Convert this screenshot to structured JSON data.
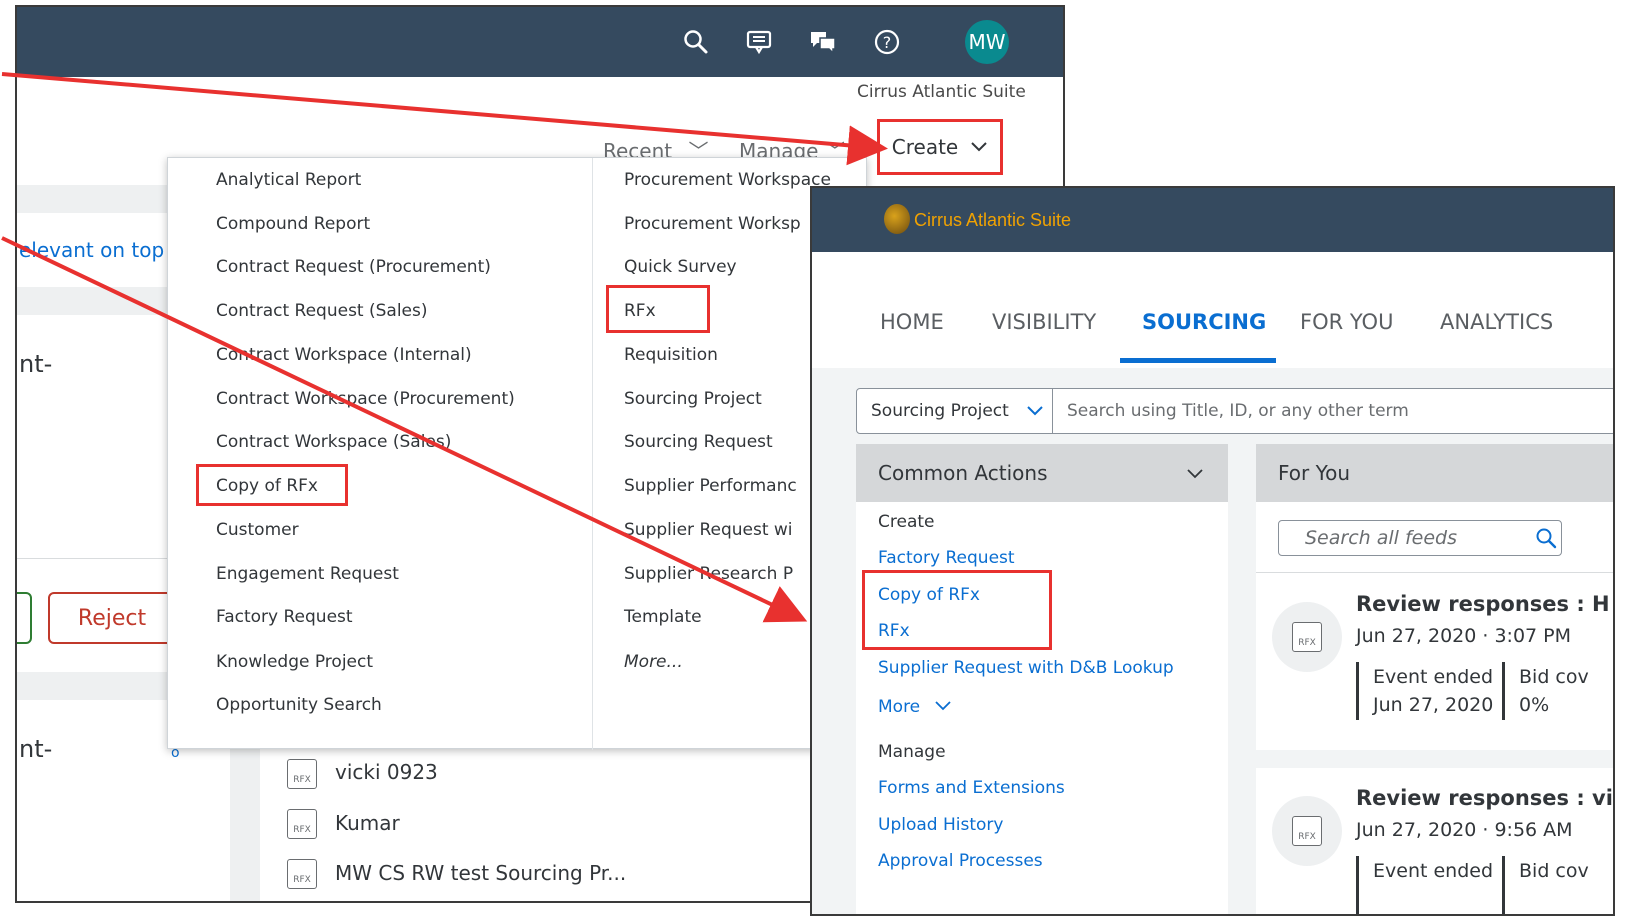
{
  "colors": {
    "shell": "#354a5f",
    "accent_blue": "#0a6ed1",
    "highlight_red": "#e8312f",
    "avatar_bg": "#0a8a8f",
    "logo_orange": "#f0a202"
  },
  "bg_window": {
    "avatar_initials": "MW",
    "suite_name": "Cirrus Atlantic Suite",
    "icons": [
      "search-icon",
      "feedback-icon",
      "chat-icon",
      "help-icon"
    ],
    "nav": {
      "recent": "Recent",
      "manage": "Manage",
      "create": "Create"
    },
    "fragments": {
      "relevant": "elevant on top",
      "doc1": "nt-",
      "doc2": "nt-",
      "reject": "Reject"
    },
    "list": [
      "vicki 0923",
      "Kumar",
      "MW CS RW test Sourcing Pr..."
    ],
    "rfx_label": "RFX"
  },
  "create_menu": {
    "col1": [
      "Analytical Report",
      "Compound Report",
      "Contract Request (Procurement)",
      "Contract Request (Sales)",
      "Contract Workspace (Internal)",
      "Contract Workspace (Procurement)",
      "Contract Workspace (Sales)",
      "Copy of RFx",
      "Customer",
      "Engagement Request",
      "Factory Request",
      "Knowledge Project",
      "Opportunity Search"
    ],
    "col2": [
      "Procurement Workspace",
      "Procurement Worksp",
      "Quick Survey",
      "RFx",
      "Requisition",
      "Sourcing Project",
      "Sourcing Request",
      "Supplier Performanc",
      "Supplier Request wi",
      "Supplier Research P",
      "Template",
      "More..."
    ]
  },
  "fg_window": {
    "logo_text": "Cirrus Atlantic Suite",
    "tabs": [
      "HOME",
      "VISIBILITY",
      "SOURCING",
      "FOR YOU",
      "ANALYTICS"
    ],
    "active_tab": "SOURCING",
    "search": {
      "category": "Sourcing Project",
      "placeholder": "Search using Title, ID, or any other term"
    },
    "common_actions": {
      "title": "Common Actions",
      "create_heading": "Create",
      "create_links": [
        "Factory Request",
        "Copy of RFx",
        "RFx",
        "Supplier Request with D&B Lookup"
      ],
      "more": "More",
      "manage_heading": "Manage",
      "manage_links": [
        "Forms and Extensions",
        "Upload History",
        "Approval Processes"
      ]
    },
    "for_you": {
      "title": "For You",
      "search_placeholder": "Search all feeds",
      "feeds": [
        {
          "title": "Review responses : H",
          "date": "Jun 27, 2020 · 3:07 PM",
          "status_label": "Event ended",
          "status_value": "Jun 27, 2020",
          "metric_label": "Bid cov",
          "metric_value": "0%",
          "icon_label": "RFX"
        },
        {
          "title": "Review responses : vi",
          "date": "Jun 27, 2020 · 9:56 AM",
          "status_label": "Event ended",
          "metric_label": "Bid cov",
          "icon_label": "RFX"
        }
      ]
    }
  }
}
